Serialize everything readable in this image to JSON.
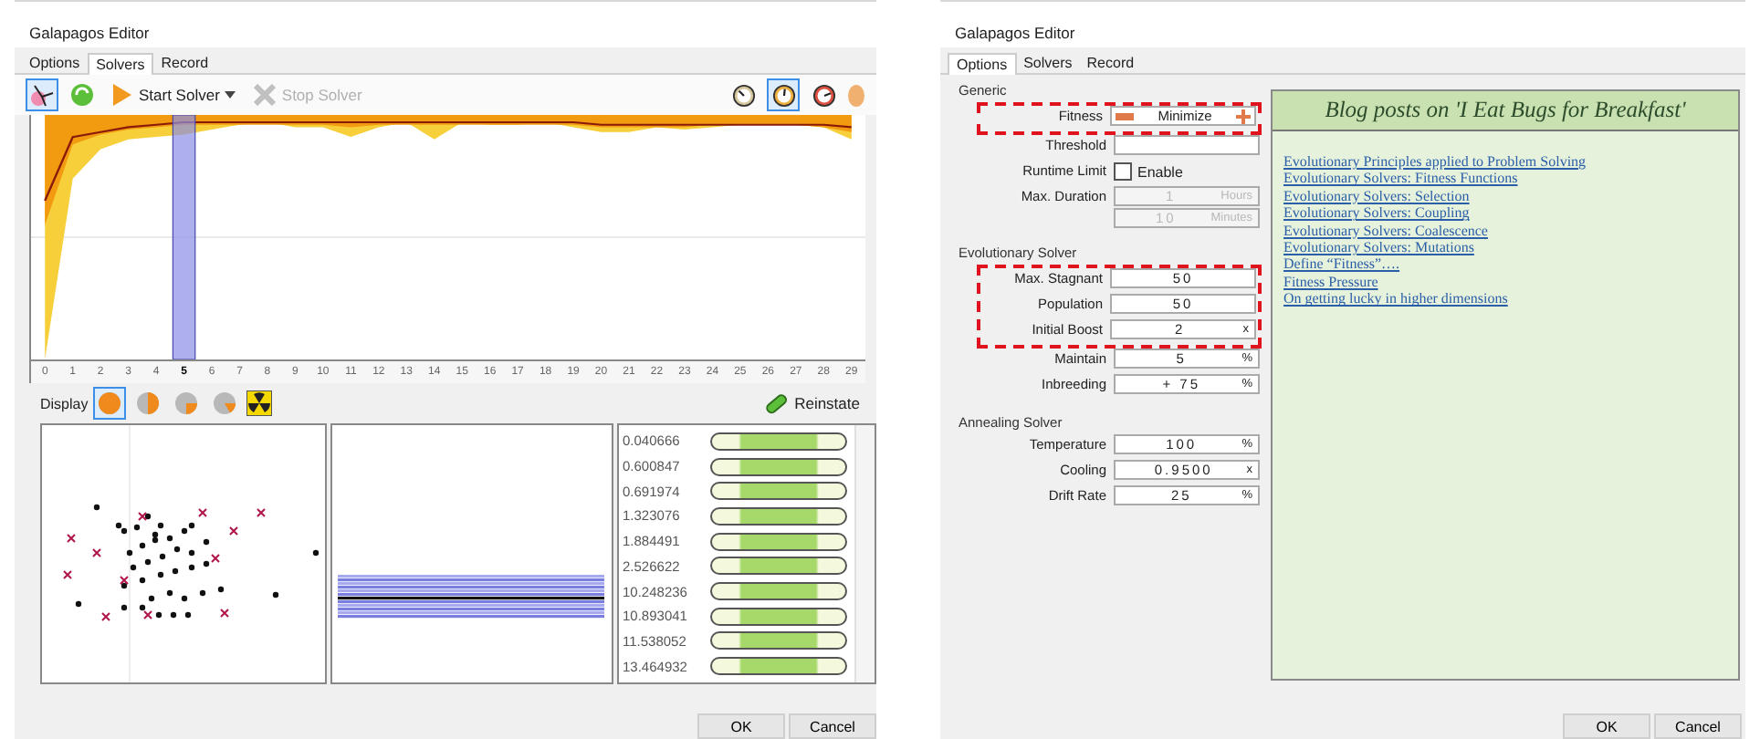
{
  "left_window": {
    "title": "Galapagos Editor",
    "tabs": [
      {
        "label": "Options",
        "selected": false
      },
      {
        "label": "Solvers",
        "selected": true
      },
      {
        "label": "Record",
        "selected": false
      }
    ],
    "toolbar": {
      "tools": [
        {
          "kind": "graph",
          "selected": true
        },
        {
          "kind": "refresh",
          "selected": false
        }
      ],
      "start_solver": "Start Solver",
      "stop_solver": {
        "label": "Stop Solver",
        "disabled": true
      },
      "gauges": [
        {
          "selected": false
        },
        {
          "selected": true
        },
        {
          "selected": false
        }
      ]
    },
    "chart": {
      "x_labels": [
        {
          "label": "0",
          "selected": false
        },
        {
          "label": "1",
          "selected": false
        },
        {
          "label": "2",
          "selected": false
        },
        {
          "label": "3",
          "selected": false
        },
        {
          "label": "4",
          "selected": false
        },
        {
          "label": "5",
          "selected": true
        },
        {
          "label": "6",
          "selected": false
        },
        {
          "label": "7",
          "selected": false
        },
        {
          "label": "8",
          "selected": false
        },
        {
          "label": "9",
          "selected": false
        },
        {
          "label": "10",
          "selected": false
        },
        {
          "label": "11",
          "selected": false
        },
        {
          "label": "12",
          "selected": false
        },
        {
          "label": "13",
          "selected": false
        },
        {
          "label": "14",
          "selected": false
        },
        {
          "label": "15",
          "selected": false
        },
        {
          "label": "16",
          "selected": false
        },
        {
          "label": "17",
          "selected": false
        },
        {
          "label": "18",
          "selected": false
        },
        {
          "label": "19",
          "selected": false
        },
        {
          "label": "20",
          "selected": false
        },
        {
          "label": "21",
          "selected": false
        },
        {
          "label": "22",
          "selected": false
        },
        {
          "label": "23",
          "selected": false
        },
        {
          "label": "24",
          "selected": false
        },
        {
          "label": "25",
          "selected": false
        },
        {
          "label": "26",
          "selected": false
        },
        {
          "label": "27",
          "selected": false
        },
        {
          "label": "28",
          "selected": false
        },
        {
          "label": "29",
          "selected": false
        }
      ]
    },
    "display_bar": {
      "label": "Display",
      "modes": [
        {
          "selected": true
        },
        {
          "selected": false
        },
        {
          "selected": false
        },
        {
          "selected": false
        }
      ],
      "reinstate": "Reinstate"
    },
    "genomes": [
      "0.040666",
      "0.600847",
      "0.691974",
      "1.323076",
      "1.884491",
      "2.526622",
      "10.248236",
      "10.893041",
      "11.538052",
      "13.464932"
    ],
    "buttons": [
      "OK",
      "Cancel"
    ]
  },
  "right_window": {
    "title": "Galapagos Editor",
    "tabs": [
      {
        "label": "Options",
        "selected": true
      },
      {
        "label": "Solvers",
        "selected": false
      },
      {
        "label": "Record",
        "selected": false
      }
    ],
    "sections": [
      {
        "title": "Generic",
        "rows": [
          {
            "kind": "toggle",
            "label": "Fitness",
            "value": "Minimize",
            "highlighted": true
          },
          {
            "kind": "field",
            "label": "Threshold",
            "highlighted": false
          },
          {
            "kind": "checkbox",
            "label": "Runtime Limit",
            "text": "Enable",
            "checked": false,
            "highlighted": false
          },
          {
            "kind": "duration",
            "label": "Max. Duration",
            "fields": [
              {
                "value": "1",
                "unit": "Hours"
              },
              {
                "value": "10",
                "unit": "Minutes"
              }
            ],
            "disabled": true,
            "highlighted": false
          }
        ]
      },
      {
        "title": "Evolutionary Solver",
        "rows": [
          {
            "kind": "field",
            "label": "Max. Stagnant",
            "value": "50",
            "highlighted": true
          },
          {
            "kind": "field",
            "label": "Population",
            "value": "50",
            "highlighted": true
          },
          {
            "kind": "field",
            "label": "Initial Boost",
            "value": "2",
            "unit": "x",
            "highlighted": true
          },
          {
            "kind": "field",
            "label": "Maintain",
            "value": "5",
            "unit": "%",
            "highlighted": false
          },
          {
            "kind": "field",
            "label": "Inbreeding",
            "value": "+ 75",
            "unit": "%",
            "highlighted": false
          }
        ]
      },
      {
        "title": "Annealing Solver",
        "rows": [
          {
            "kind": "field",
            "label": "Temperature",
            "value": "100",
            "unit": "%",
            "highlighted": false
          },
          {
            "kind": "field",
            "label": "Cooling",
            "value": "0.9500",
            "unit": "x",
            "highlighted": false
          },
          {
            "kind": "field",
            "label": "Drift Rate",
            "value": "25",
            "unit": "%",
            "highlighted": false
          }
        ]
      }
    ],
    "blog": {
      "title": "Blog posts on 'I Eat Bugs for Breakfast'",
      "links": [
        "Evolutionary Principles applied to Problem Solving",
        "Evolutionary Solvers: Fitness Functions",
        "Evolutionary Solvers: Selection",
        "Evolutionary Solvers: Coupling",
        "Evolutionary Solvers: Coalescence",
        "Evolutionary Solvers: Mutations",
        "Define “Fitness”….",
        "Fitness Pressure",
        "On getting lucky in higher dimensions"
      ]
    },
    "buttons": [
      "OK",
      "Cancel"
    ]
  }
}
